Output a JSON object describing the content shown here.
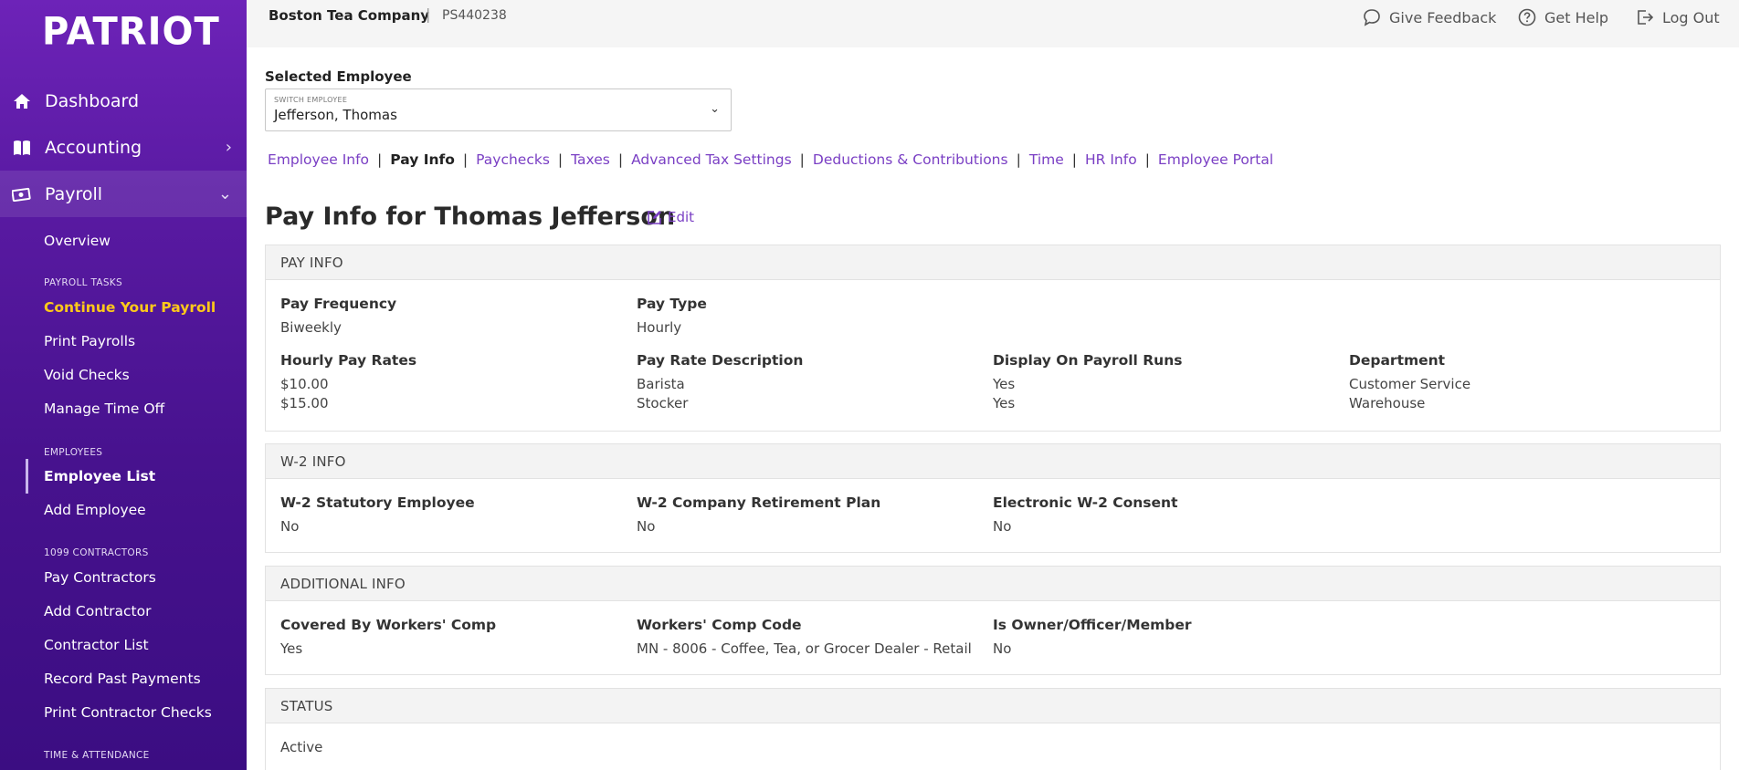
{
  "brand": {
    "logo": "PATRIOT"
  },
  "sidebar": {
    "main": [
      {
        "label": "Dashboard"
      },
      {
        "label": "Accounting"
      },
      {
        "label": "Payroll"
      }
    ],
    "overview": "Overview",
    "sections": {
      "payroll_tasks": "PAYROLL TASKS",
      "employees": "EMPLOYEES",
      "contractors": "1099 CONTRACTORS",
      "time_attendance": "TIME & ATTENDANCE"
    },
    "payroll_tasks": [
      "Continue Your Payroll",
      "Print Payrolls",
      "Void Checks",
      "Manage Time Off"
    ],
    "employees": [
      "Employee List",
      "Add Employee"
    ],
    "contractors": [
      "Pay Contractors",
      "Add Contractor",
      "Contractor List",
      "Record Past Payments",
      "Print Contractor Checks"
    ]
  },
  "topbar": {
    "company": "Boston Tea Company",
    "separator": "|",
    "company_id": "PS440238",
    "feedback": "Give Feedback",
    "help": "Get Help",
    "logout": "Log Out"
  },
  "employee_select": {
    "label": "Selected Employee",
    "small_label": "SWITCH EMPLOYEE",
    "value": "Jefferson, Thomas",
    "caret": "⌄"
  },
  "tabs": [
    "Employee Info",
    "Pay Info",
    "Paychecks",
    "Taxes",
    "Advanced Tax Settings",
    "Deductions & Contributions",
    "Time",
    "HR Info",
    "Employee Portal"
  ],
  "tab_separator": "|",
  "page": {
    "title": "Pay Info for Thomas Jefferson",
    "edit": "Edit"
  },
  "pay_info": {
    "header": "PAY INFO",
    "pay_frequency": {
      "label": "Pay Frequency",
      "value": "Biweekly"
    },
    "pay_type": {
      "label": "Pay Type",
      "value": "Hourly"
    },
    "hourly_rates": {
      "label": "Hourly Pay Rates",
      "values": [
        "$10.00",
        "$15.00"
      ]
    },
    "rate_description": {
      "label": "Pay Rate Description",
      "values": [
        "Barista",
        "Stocker"
      ]
    },
    "display_on_runs": {
      "label": "Display On Payroll Runs",
      "values": [
        "Yes",
        "Yes"
      ]
    },
    "department": {
      "label": "Department",
      "values": [
        "Customer Service",
        "Warehouse"
      ]
    }
  },
  "w2_info": {
    "header": "W-2 INFO",
    "statutory": {
      "label": "W-2 Statutory Employee",
      "value": "No"
    },
    "retirement": {
      "label": "W-2 Company Retirement Plan",
      "value": "No"
    },
    "consent": {
      "label": "Electronic W-2 Consent",
      "value": "No"
    }
  },
  "additional_info": {
    "header": "ADDITIONAL INFO",
    "workers_comp": {
      "label": "Covered By Workers' Comp",
      "value": "Yes"
    },
    "comp_code": {
      "label": "Workers' Comp Code",
      "value": "MN - 8006 - Coffee, Tea, or Grocer Dealer - Retail"
    },
    "owner": {
      "label": "Is Owner/Officer/Member",
      "value": "No"
    }
  },
  "status": {
    "header": "STATUS",
    "value": "Active"
  },
  "colors": {
    "sidebar_top": "#6d23b8",
    "sidebar_bottom": "#3b0d82",
    "accent": "#7a3fc4",
    "highlight": "#ffc91a"
  }
}
